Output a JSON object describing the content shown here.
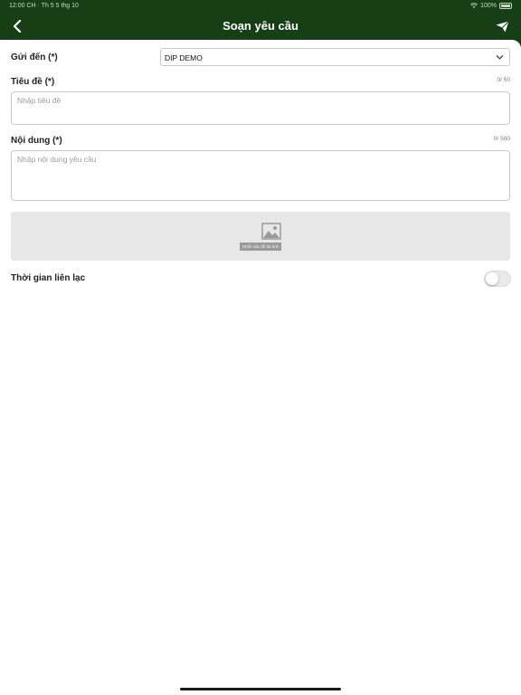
{
  "status_bar": {
    "time_date": "12:00 CH · Th 5 5 thg 10",
    "battery": "100%"
  },
  "header": {
    "title": "Soạn yêu cầu",
    "back_icon": "chevron-left-icon",
    "send_icon": "paper-plane-icon",
    "color": "#173f16"
  },
  "form": {
    "send_to": {
      "label": "Gửi đến (*)",
      "value": "DIP DEMO"
    },
    "subject": {
      "label": "Tiêu đề (*)",
      "counter": "0/ 50",
      "placeholder": "Nhập tiêu đề"
    },
    "content": {
      "label": "Nội dung (*)",
      "counter": "0/ 500",
      "placeholder": "Nhập nội dung yêu cầu"
    },
    "image": {
      "icon": "image-icon",
      "caption": "Nhấn vào để tải ảnh"
    },
    "contact_time": {
      "label": "Thời gian liên lạc",
      "enabled": false
    }
  }
}
